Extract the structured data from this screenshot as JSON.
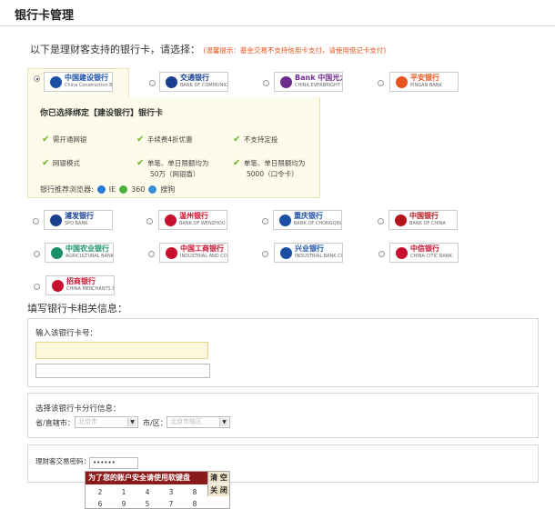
{
  "page": {
    "title": "银行卡管理",
    "prompt": "以下是理财客支持的银行卡，请选择：",
    "tip": "(温馨提示：基金交易不支持信用卡支付，请使用借记卡支付)"
  },
  "banks": [
    {
      "id": "ccb",
      "name": "中国建设银行",
      "sub": "China Construction Bank",
      "color": "#1b4fa3",
      "selected": true
    },
    {
      "id": "bocom",
      "name": "交通银行",
      "sub": "BANK OF COMMUNICATIONS",
      "color": "#1a3f8f",
      "selected": false
    },
    {
      "id": "ceb",
      "name": "Bank 中国光大银行",
      "sub": "CHINA EVERBRIGHT BANK",
      "color": "#6b2c8c",
      "selected": false
    },
    {
      "id": "pingan",
      "name": "平安银行",
      "sub": "PINGAN BANK",
      "color": "#e8541e",
      "selected": false
    },
    {
      "id": "spdb",
      "name": "浦发银行",
      "sub": "SPD BANK",
      "color": "#1a3f8f",
      "selected": false
    },
    {
      "id": "wzb",
      "name": "温州银行",
      "sub": "BANK OF WENZHOU",
      "color": "#c8102e",
      "selected": false
    },
    {
      "id": "cqb",
      "name": "重庆银行",
      "sub": "BANK OF CHONGQING",
      "color": "#1b4fa3",
      "selected": false
    },
    {
      "id": "boc",
      "name": "中国银行",
      "sub": "BANK OF CHINA",
      "color": "#b4151b",
      "selected": false
    },
    {
      "id": "abc",
      "name": "中国农业银行",
      "sub": "AGRICULTURAL BANK OF CHINA",
      "color": "#1a8f6a",
      "selected": false
    },
    {
      "id": "icbc",
      "name": "中国工商银行",
      "sub": "INDUSTRIAL AND COMMERCIAL BANK OF CHINA",
      "color": "#c8102e",
      "selected": false
    },
    {
      "id": "cib",
      "name": "兴业银行",
      "sub": "INDUSTRIAL BANK CO.,LTD",
      "color": "#1b4fa3",
      "selected": false
    },
    {
      "id": "citic",
      "name": "中信银行",
      "sub": "CHINA CITIC BANK",
      "color": "#c8102e",
      "selected": false
    },
    {
      "id": "cmb",
      "name": "招商银行",
      "sub": "CHINA MERCHANTS BANK",
      "color": "#c8102e",
      "selected": false
    }
  ],
  "panel": {
    "title": "你已选择绑定【建设银行】银行卡",
    "features": [
      {
        "lines": [
          "需开通网银"
        ]
      },
      {
        "lines": [
          "手续费4折优惠"
        ]
      },
      {
        "lines": [
          "不支持定投"
        ]
      },
      {
        "lines": [
          "网银模式"
        ]
      },
      {
        "lines": [
          "单笔、单日限额均为",
          "50万（网银盾）"
        ]
      },
      {
        "lines": [
          "单笔、单日限额均为",
          "5000（口令卡）"
        ]
      }
    ],
    "browser_label": "银行推荐浏览器:",
    "browsers": [
      "IE",
      "360",
      "搜狗"
    ]
  },
  "form": {
    "section_title": "填写银行卡相关信息：",
    "card_label": "输入该银行卡号：",
    "branch_label": "选择该银行卡分行信息：",
    "province_label": "省/直辖市：",
    "province_value": "北京市",
    "city_label": "市/区：",
    "city_value": "北京市辖区",
    "password_label": "理财客交易密码：",
    "password_value": "••••••"
  },
  "keyboard": {
    "header": "为了您的账户安全请使用软键盘",
    "row1": [
      "2",
      "1",
      "4",
      "3",
      "8"
    ],
    "row2": [
      "6",
      "9",
      "5",
      "7",
      "8"
    ],
    "clear_label": "清 空",
    "close_label": "关 闭"
  }
}
